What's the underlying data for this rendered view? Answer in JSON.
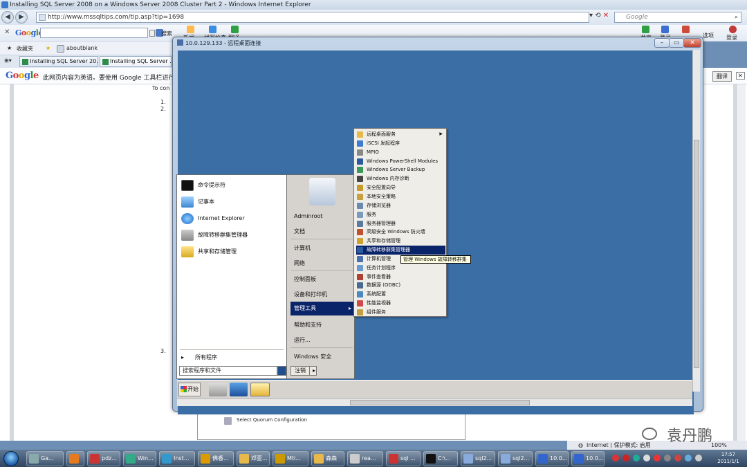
{
  "ie": {
    "title": "Installing SQL Server 2008 on a Windows Server 2008 Cluster Part 2 - Windows Internet Explorer",
    "url": "http://www.mssqltips.com/tip.asp?tip=1698",
    "search_placeholder": "Google",
    "status_zone": "Internet | 保护模式: 启用",
    "zoom": "100%"
  },
  "google_toolbar": {
    "logo": "Google",
    "search_btn": "搜索",
    "items": [
      "新闻",
      "拼写检查",
      "翻译",
      "共享",
      "登录",
      "选项",
      "登录"
    ],
    "translate_msg": "此网页内容为英语。要使用 Google 工具栏进行",
    "translate_btn": "翻译"
  },
  "favorites": {
    "fav": "收藏夹",
    "link": "aboutblank"
  },
  "tabs": [
    "Installing SQL Server 20...",
    "Installing SQL Server ..."
  ],
  "page": {
    "to_con": "To con",
    "list": [
      "1.",
      "2.",
      "3."
    ],
    "quorum": "Select Quorum Configuration"
  },
  "rdp": {
    "title": "10.0.129.133 - 远程桌面连接"
  },
  "start_menu": {
    "left_items": [
      "命令提示符",
      "记事本",
      "Internet Explorer",
      "故障转移群集管理器",
      "共享和存储管理"
    ],
    "all_programs": "所有程序",
    "search_placeholder": "搜索程序和文件",
    "right_items": [
      "Adminroot",
      "文档",
      "计算机",
      "网络",
      "控制面板",
      "设备和打印机",
      "管理工具",
      "帮助和支持",
      "运行...",
      "Windows 安全"
    ],
    "logoff": "注销"
  },
  "admin_tools": {
    "items": [
      {
        "label": "远程桌面服务",
        "arrow": true
      },
      {
        "label": "iSCSI 发起程序"
      },
      {
        "label": "MPIO"
      },
      {
        "label": "Windows PowerShell Modules"
      },
      {
        "label": "Windows Server Backup"
      },
      {
        "label": "Windows 内存诊断"
      },
      {
        "label": "安全配置向导"
      },
      {
        "label": "本地安全策略"
      },
      {
        "label": "存储浏览器"
      },
      {
        "label": "服务"
      },
      {
        "label": "服务器管理器"
      },
      {
        "label": "高级安全 Windows 防火墙"
      },
      {
        "label": "共享和存储管理"
      },
      {
        "label": "故障转移群集管理器",
        "selected": true
      },
      {
        "label": "计算机管理"
      },
      {
        "label": "任务计划程序"
      },
      {
        "label": "事件查看器"
      },
      {
        "label": "数据源 (ODBC)"
      },
      {
        "label": "系统配置"
      },
      {
        "label": "性能监视器"
      },
      {
        "label": "组件服务"
      }
    ],
    "tooltip": "管理 Windows 故障转移群集"
  },
  "server_taskbar": {
    "start": "开始"
  },
  "taskbar": {
    "items": [
      "Ga...",
      "",
      "pdz...",
      "Win...",
      "Inst...",
      "佛香...",
      "邓亚...",
      "Mti...",
      "森森",
      "rea...",
      "sql ...",
      "C:\\...",
      "sql2...",
      "sql2...",
      "10.0...",
      "10.0..."
    ],
    "time": "17:57",
    "date": "2011/1/1"
  },
  "watermark": "袁丹鹏",
  "colors": {
    "desktop": "#3a6ea5",
    "selection": "#0a246a"
  }
}
